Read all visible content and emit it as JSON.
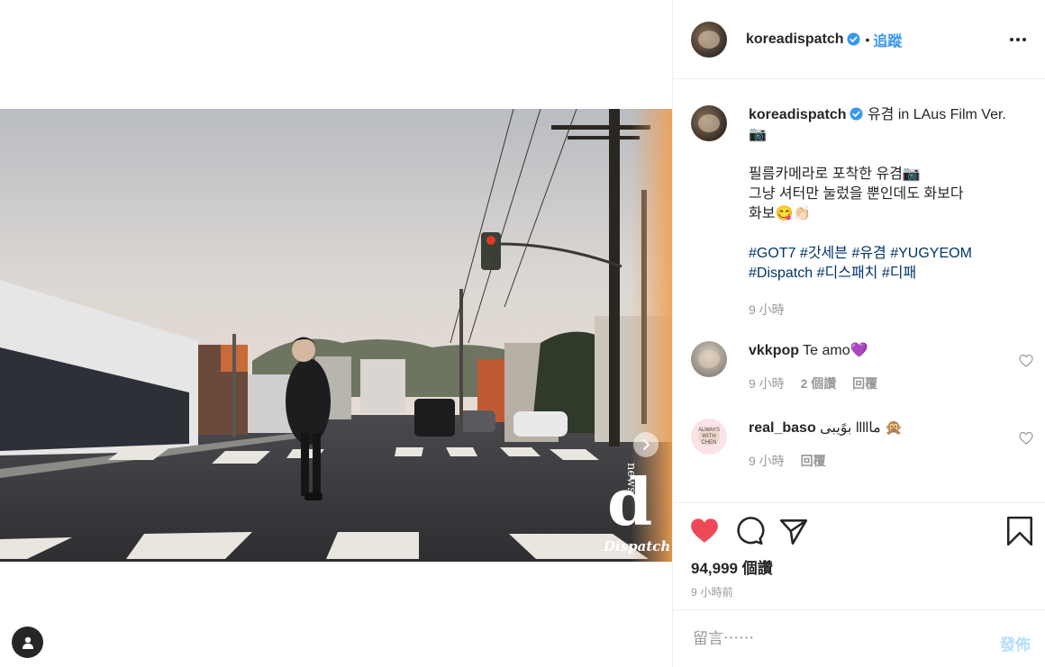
{
  "post": {
    "author": "koreadispatch",
    "follow_label": "追蹤",
    "separator": "•",
    "watermark": {
      "letter": "d",
      "small": "news",
      "brand": "Dispatch"
    }
  },
  "caption": {
    "username": "koreadispatch",
    "title_line": "유겸 in LAus Film Ver.",
    "camera_emoji": "📷",
    "line2": "필름카메라로 포착한 유겸📷",
    "line3": "그냥 셔터만 눌렀을 뿐인데도 화보다",
    "line4": "화보😋👏🏻",
    "hashtags_line1": [
      "#GOT7",
      "#갓세븐",
      "#유겸",
      "#YUGYEOM"
    ],
    "hashtags_line2": [
      "#Dispatch",
      "#디스패치",
      "#디패"
    ],
    "time": "9 小時"
  },
  "comments": [
    {
      "username": "vkkpop",
      "text": "Te amo💜",
      "time": "9 小時",
      "likes": "2 個讚",
      "reply": "回覆",
      "avatar_color": "#b8b0a8"
    },
    {
      "username": "real_baso",
      "text": "بوًيبى llllما 🙊",
      "time": "9 小時",
      "reply": "回覆",
      "avatar_text": "ALWAYS WITH CHEN",
      "avatar_color": "#fbe3e8"
    }
  ],
  "footer": {
    "likes": "94,999 個讚",
    "time": "9 小時前",
    "comment_placeholder": "留言⋯⋯",
    "post_label": "發佈"
  },
  "colors": {
    "link": "#3897f0",
    "like_red": "#ed4956",
    "hashtag": "#003569",
    "muted": "#999999"
  }
}
